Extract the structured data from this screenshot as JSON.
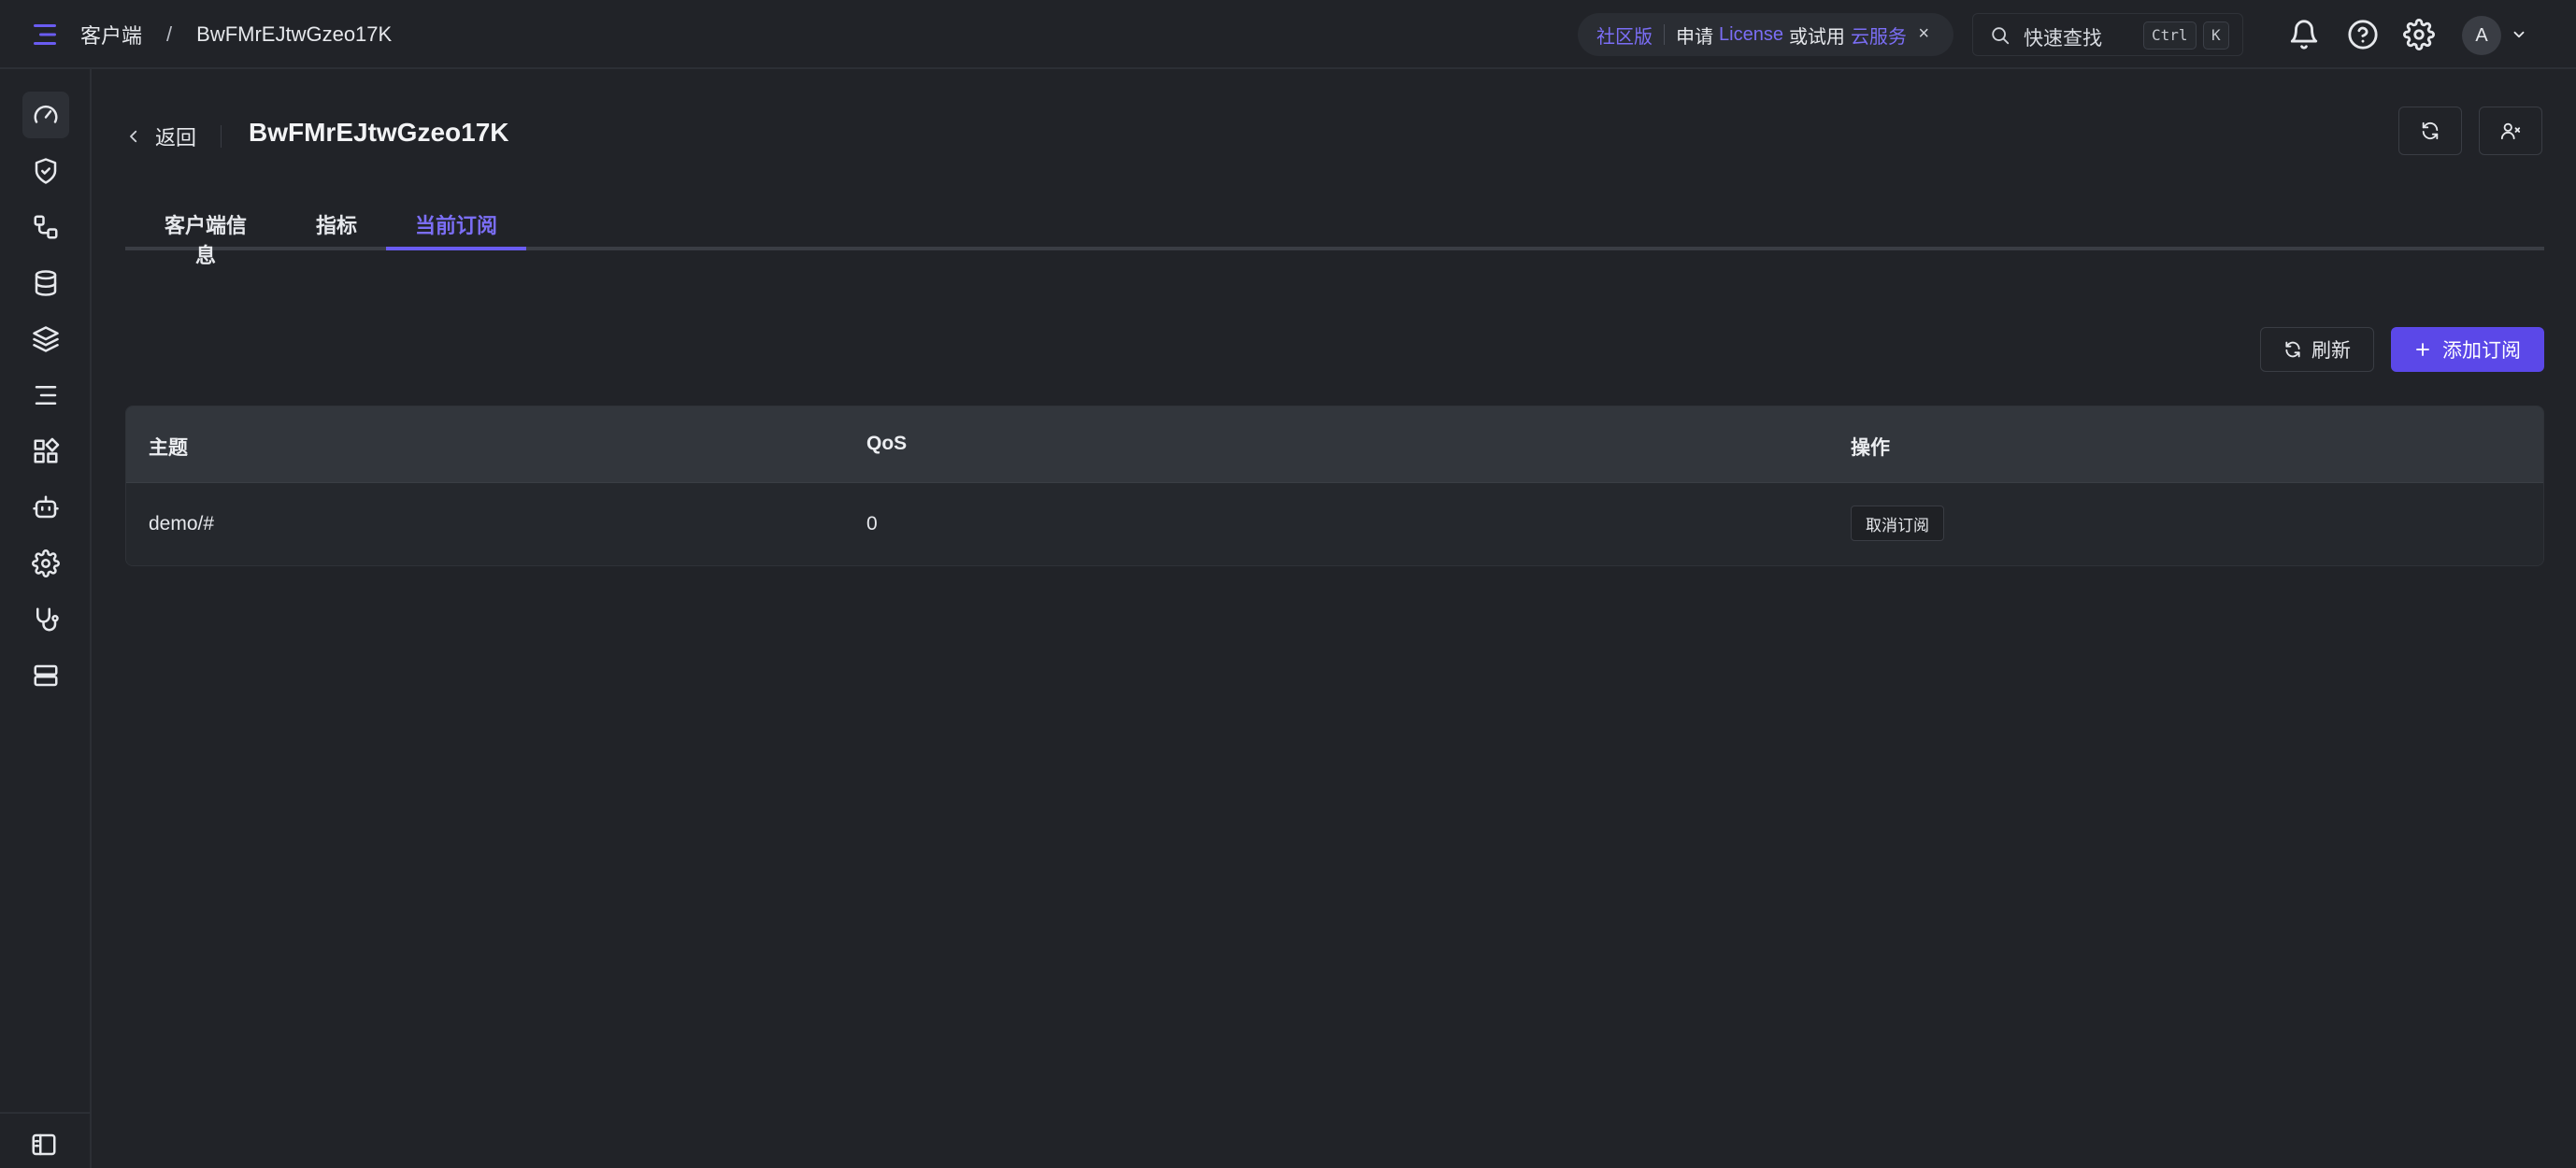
{
  "header": {
    "breadcrumb": [
      "客户端",
      "/",
      "BwFMrEJtwGzeo17K"
    ],
    "promo": {
      "edition": "社区版",
      "text_apply": "申请",
      "license": "License",
      "text_or_try": "或试用",
      "cloud": "云服务",
      "close": "×"
    },
    "search": {
      "label": "快速查找",
      "kbd_ctrl": "Ctrl",
      "kbd_k": "K"
    },
    "avatar_initial": "A",
    "icons": [
      "bell-icon",
      "help-icon",
      "settings-icon",
      "chevron-down-icon"
    ]
  },
  "sidebar": {
    "items": [
      {
        "icon": "dashboard-gauge-icon",
        "active": true
      },
      {
        "icon": "shield-check-icon"
      },
      {
        "icon": "connections-icon"
      },
      {
        "icon": "database-icon"
      },
      {
        "icon": "layers-icon"
      },
      {
        "icon": "list-lines-icon"
      },
      {
        "icon": "extensions-grid-icon"
      },
      {
        "icon": "bot-icon"
      },
      {
        "icon": "gear-icon"
      },
      {
        "icon": "stethoscope-icon"
      },
      {
        "icon": "server-icon"
      }
    ],
    "collapse_icon": "sidebar-collapse-icon"
  },
  "page": {
    "back_label": "返回",
    "title": "BwFMrEJtwGzeo17K",
    "tabs": [
      {
        "label": "客户端信息"
      },
      {
        "label": "指标"
      },
      {
        "label": "当前订阅",
        "active": true
      }
    ],
    "actions": {
      "refresh_label": "刷新",
      "add_label": "添加订阅"
    }
  },
  "table": {
    "columns": [
      "主题",
      "QoS",
      "操作"
    ],
    "rows": [
      {
        "topic": "demo/#",
        "qos": "0",
        "action": "取消订阅"
      }
    ]
  },
  "colors": {
    "background": "#212328",
    "accent": "#6a5cf2",
    "primary_button": "#5b48e8",
    "table_header": "#32363c"
  }
}
